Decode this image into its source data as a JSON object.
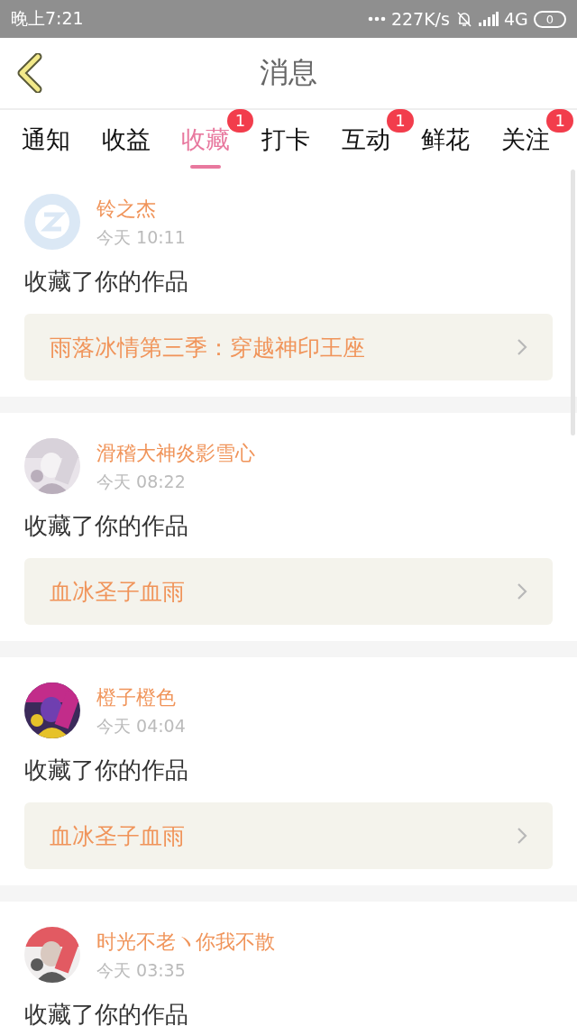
{
  "status_bar": {
    "time": "晚上7:21",
    "net_speed": "227K/s",
    "network": "4G",
    "battery": "0"
  },
  "header": {
    "title": "消息"
  },
  "tabs": [
    {
      "label": "通知",
      "selected": false
    },
    {
      "label": "收益",
      "selected": false
    },
    {
      "label": "收藏",
      "selected": true,
      "badge": "1"
    },
    {
      "label": "打卡",
      "selected": false
    },
    {
      "label": "互动",
      "selected": false,
      "badge": "1"
    },
    {
      "label": "鲜花",
      "selected": false
    },
    {
      "label": "关注",
      "selected": false,
      "badge": "1"
    }
  ],
  "messages": [
    {
      "user": "铃之杰",
      "avatar": {
        "kind": "default"
      },
      "time": "今天 10:11",
      "action": "收藏了你的作品",
      "work": "雨落冰情第三季：穿越神印王座"
    },
    {
      "user": "滑稽大神炎影雪心",
      "time": "今天 08:22",
      "action": "收藏了你的作品",
      "work": "血冰圣子血雨"
    },
    {
      "user": "橙子橙色",
      "time": "今天 04:04",
      "action": "收藏了你的作品",
      "work": "血冰圣子血雨"
    },
    {
      "user": "时光不老ヽ你我不散",
      "time": "今天 03:35",
      "action": "收藏了你的作品"
    }
  ]
}
